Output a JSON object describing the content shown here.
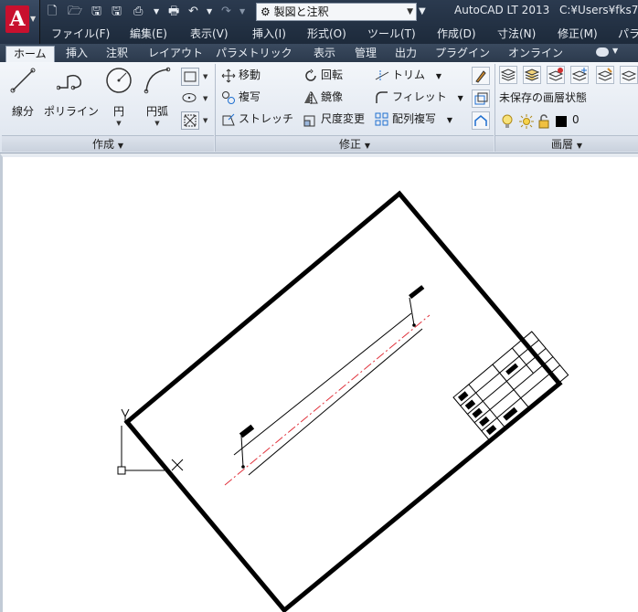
{
  "titlebar": {
    "app_logo": "A",
    "workspace": "製図と注釈",
    "title": "AutoCAD LT 2013",
    "path": "C:¥Users¥fks7"
  },
  "menu": [
    "ファイル(F)",
    "編集(E)",
    "表示(V)",
    "挿入(I)",
    "形式(O)",
    "ツール(T)",
    "作成(D)",
    "寸法(N)",
    "修正(M)",
    "パラ"
  ],
  "tabs": [
    "ホーム",
    "挿入",
    "注釈",
    "レイアウト",
    "パラメトリック",
    "表示",
    "管理",
    "出力",
    "プラグイン",
    "オンライン"
  ],
  "panels": {
    "draw": {
      "title": "作成",
      "line": "線分",
      "polyline": "ポリライン",
      "circle": "円",
      "arc": "円弧"
    },
    "modify": {
      "title": "修正",
      "move": "移動",
      "copy": "複写",
      "stretch": "ストレッチ",
      "rotate": "回転",
      "mirror": "鏡像",
      "scale": "尺度変更",
      "trim": "トリム",
      "fillet": "フィレット",
      "array": "配列複写"
    },
    "layers": {
      "title": "画層",
      "state": "未保存の画層状態",
      "current_layer": "0"
    }
  },
  "colors": {
    "titlebar": "#243247",
    "accent_red": "#c8102e",
    "centerline": "#e0303a"
  }
}
